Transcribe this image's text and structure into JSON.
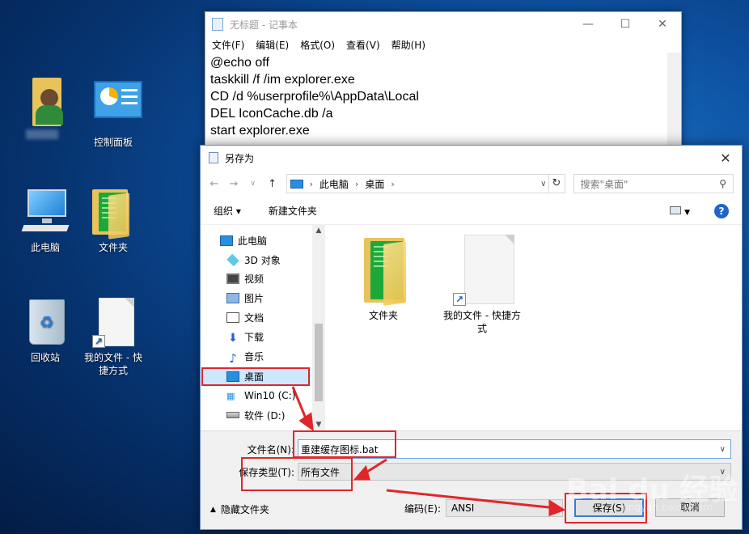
{
  "desktop": {
    "icons": [
      {
        "label": "",
        "type": "user"
      },
      {
        "label": "控制面板",
        "type": "control"
      },
      {
        "label": "此电脑",
        "type": "pc"
      },
      {
        "label": "文件夹",
        "type": "folder"
      },
      {
        "label": "回收站",
        "type": "recycle"
      },
      {
        "label": "我的文件 - 快捷方式",
        "type": "shortcut"
      }
    ]
  },
  "notepad": {
    "title": "无标题 - 记事本",
    "controls": [
      "—",
      "☐",
      "✕"
    ],
    "menu": [
      "文件(F)",
      "编辑(E)",
      "格式(O)",
      "查看(V)",
      "帮助(H)"
    ],
    "lines": [
      "@echo off",
      "taskkill /f /im explorer.exe",
      "CD /d %userprofile%\\AppData\\Local",
      "DEL IconCache.db /a",
      "start explorer.exe"
    ]
  },
  "dialog": {
    "title": "另存为",
    "close": "✕",
    "breadcrumb": [
      "此电脑",
      "桌面"
    ],
    "search_placeholder": "搜索\"桌面\"",
    "toolbar": {
      "organize": "组织 ▾",
      "new_folder": "新建文件夹"
    },
    "tree": [
      {
        "label": "此电脑",
        "icon": "pc"
      },
      {
        "label": "3D 对象",
        "icon": "3d"
      },
      {
        "label": "视频",
        "icon": "video"
      },
      {
        "label": "图片",
        "icon": "pic"
      },
      {
        "label": "文档",
        "icon": "doc"
      },
      {
        "label": "下载",
        "icon": "down"
      },
      {
        "label": "音乐",
        "icon": "music"
      },
      {
        "label": "桌面",
        "icon": "desk"
      },
      {
        "label": "Win10 (C:)",
        "icon": "win"
      },
      {
        "label": "软件 (D:)",
        "icon": "drive"
      }
    ],
    "files": [
      {
        "label": "文件夹",
        "type": "folder"
      },
      {
        "label": "我的文件 - 快捷方式",
        "type": "shortcut"
      }
    ],
    "filename_label": "文件名(N):",
    "filename_value": "重建缓存图标.bat",
    "filetype_label": "保存类型(T):",
    "filetype_value": "所有文件",
    "hide_folders": "隐藏文件夹",
    "encoding_label": "编码(E):",
    "encoding_value": "ANSI",
    "save": "保存(S)",
    "cancel": "取消"
  },
  "colors": {
    "annotation": "#e0262b",
    "accent": "#2066c9"
  },
  "watermark": {
    "text": "Bai du 经验",
    "sub": "jingyan.baidu.com"
  }
}
